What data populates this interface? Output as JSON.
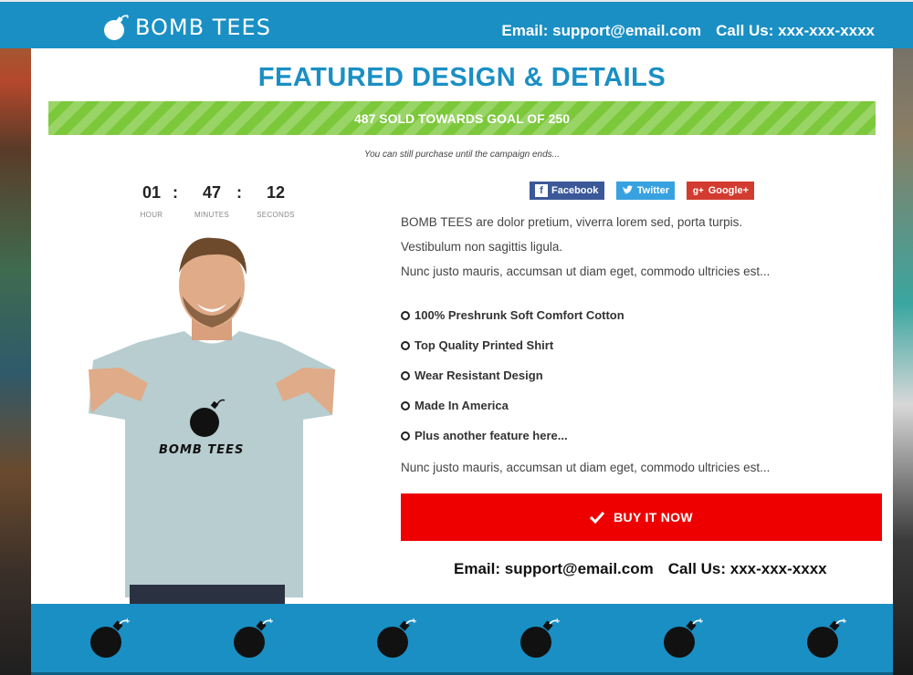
{
  "header": {
    "brand": "BOMB TEES",
    "email": "Email: support@email.com",
    "phone": "Call Us: xxx-xxx-xxxx"
  },
  "main": {
    "title": "FEATURED DESIGN & DETAILS",
    "goal_text": "487 SOLD TOWARDS GOAL OF 250",
    "note": "You can still purchase until the campaign ends...",
    "countdown": [
      {
        "value": "01",
        "label": "HOUR"
      },
      {
        "value": "47",
        "label": "MINUTES"
      },
      {
        "value": "12",
        "label": "SECONDS"
      }
    ],
    "shirt_print": "BOMB TEES"
  },
  "social": {
    "facebook": "Facebook",
    "twitter": "Twitter",
    "google": "Google+"
  },
  "description": {
    "lines": [
      "BOMB TEES are dolor pretium, viverra lorem sed, porta turpis.",
      "Vestibulum non sagittis ligula.",
      "Nunc justo mauris, accumsan ut diam eget, commodo ultricies est..."
    ],
    "features": [
      "100% Preshrunk Soft Comfort Cotton",
      "Top Quality Printed Shirt",
      "Wear Resistant Design",
      "Made In America",
      "Plus another feature here..."
    ],
    "closing": "Nunc justo mauris, accumsan ut diam eget, commodo ultricies est..."
  },
  "cta": {
    "buy_label": "BUY IT NOW"
  },
  "contact": {
    "email": "Email: support@email.com",
    "phone": "Call Us: xxx-xxx-xxxx"
  },
  "footer": {
    "icons": [
      "bomb-icon",
      "bomb-icon",
      "bomb-icon",
      "bomb-icon",
      "bomb-icon",
      "bomb-icon"
    ]
  },
  "colors": {
    "brand_blue": "#1a8fc4",
    "goal_green": "#7cc83b",
    "cta_red": "#ee0000"
  }
}
